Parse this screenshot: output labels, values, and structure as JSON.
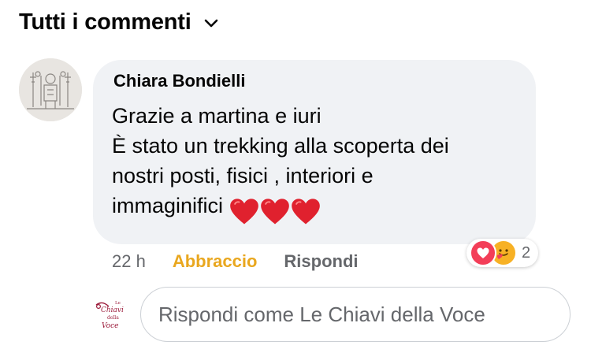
{
  "header": {
    "title": "Tutti i commenti",
    "dropdown_icon": "chevron-down-icon"
  },
  "comment": {
    "author": "Chiara Bondielli",
    "text_lines": [
      "Grazie a martina e iuri",
      "È stato un trekking alla scoperta dei",
      "nostri posti, fisici , interiori e",
      "immaginifici"
    ],
    "emoji": [
      "red-heart",
      "red-heart",
      "red-heart"
    ],
    "time": "22 h",
    "hug_label": "Abbraccio",
    "reply_label": "Rispondi",
    "reactions": {
      "icons": [
        "love-reaction-icon",
        "care-reaction-icon"
      ],
      "count": "2"
    }
  },
  "reply_box": {
    "placeholder": "Rispondi come Le Chiavi della Voce"
  },
  "page_logo": {
    "lines": [
      "Le",
      "Chiavi",
      "della",
      "Voce"
    ]
  },
  "colors": {
    "bubble": "#f0f2f5",
    "secondary_text": "#65676b",
    "hug_reaction": "#e9a71f",
    "love_reaction": "#f33e58",
    "care_reaction": "#f7b125",
    "heart": "#e0212e",
    "logo": "#9b1b3a"
  }
}
